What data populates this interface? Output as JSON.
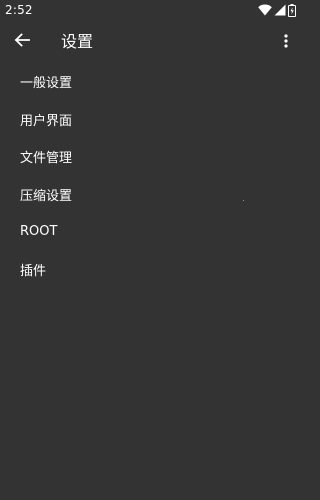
{
  "status_bar": {
    "time": "2:52",
    "icons": [
      "wifi-icon",
      "signal-icon",
      "battery-icon"
    ]
  },
  "app_bar": {
    "title": "设置",
    "back_icon": "arrow-left-icon",
    "menu_icon": "more-vertical-icon"
  },
  "settings": {
    "items": [
      {
        "label": "一般设置"
      },
      {
        "label": "用户界面"
      },
      {
        "label": "文件管理"
      },
      {
        "label": "压缩设置"
      },
      {
        "label": "ROOT"
      },
      {
        "label": "插件"
      }
    ]
  },
  "colors": {
    "background": "#333333",
    "text": "#ffffff"
  }
}
